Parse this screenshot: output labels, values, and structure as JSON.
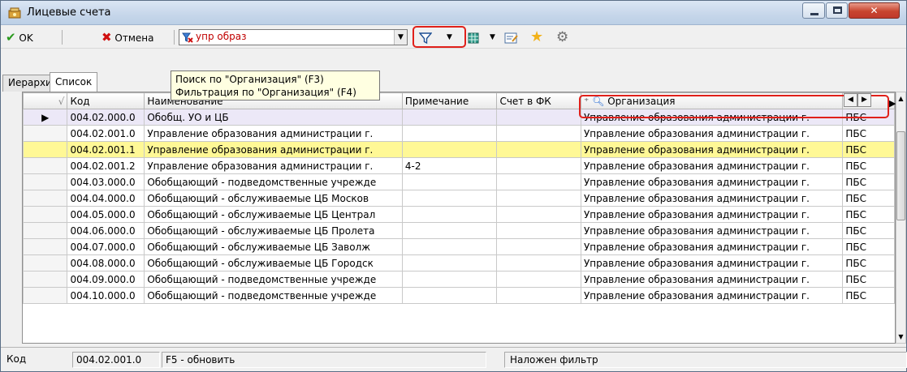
{
  "window": {
    "title": "Лицевые счета"
  },
  "toolbar": {
    "ok_label": "OK",
    "cancel_label": "Отмена",
    "search_value": "упр образ"
  },
  "tooltip": {
    "line1": "Поиск по \"Организация\" (F3)",
    "line2": "Фильтрация по \"Организация\" (F4)"
  },
  "tabs": [
    {
      "label": "Иерархия"
    },
    {
      "label": "Список"
    }
  ],
  "grid": {
    "columns": [
      "Код",
      "Наименование",
      "Примечание",
      "Счет в ФК",
      "Организация"
    ],
    "rows": [
      {
        "code": "004.02.000.0",
        "name": "Обобщ. УО и ЦБ",
        "note": "",
        "fk": "",
        "org": "Управление образования администрации г.",
        "extra": "ПБС"
      },
      {
        "code": "004.02.001.0",
        "name": "Управление образования администрации г.",
        "note": "",
        "fk": "",
        "org": "Управление образования администрации г.",
        "extra": "ПБС"
      },
      {
        "code": "004.02.001.1",
        "name": "Управление образования администрации г.",
        "note": "",
        "fk": "",
        "org": "Управление образования администрации г.",
        "extra": "ПБС"
      },
      {
        "code": "004.02.001.2",
        "name": "Управление образования администрации г.",
        "note": "4-2",
        "fk": "",
        "org": "Управление образования администрации г.",
        "extra": "ПБС"
      },
      {
        "code": "004.03.000.0",
        "name": "Обобщающий - подведомственные учрежде",
        "note": "",
        "fk": "",
        "org": "Управление образования администрации г.",
        "extra": "ПБС"
      },
      {
        "code": "004.04.000.0",
        "name": "Обобщающий - обслуживаемые ЦБ Москов",
        "note": "",
        "fk": "",
        "org": "Управление образования администрации г.",
        "extra": "ПБС"
      },
      {
        "code": "004.05.000.0",
        "name": "Обобщающий - обслуживаемые ЦБ Централ",
        "note": "",
        "fk": "",
        "org": "Управление образования администрации г.",
        "extra": "ПБС"
      },
      {
        "code": "004.06.000.0",
        "name": "Обобщающий - обслуживаемые ЦБ Пролета",
        "note": "",
        "fk": "",
        "org": "Управление образования администрации г.",
        "extra": "ПБС"
      },
      {
        "code": "004.07.000.0",
        "name": "Обобщающий - обслуживаемые ЦБ Заволж",
        "note": "",
        "fk": "",
        "org": "Управление образования администрации г.",
        "extra": "ПБС"
      },
      {
        "code": "004.08.000.0",
        "name": "Обобщающий - обслуживаемые ЦБ Городск",
        "note": "",
        "fk": "",
        "org": "Управление образования администрации г.",
        "extra": "ПБС"
      },
      {
        "code": "004.09.000.0",
        "name": "Обобщающий - подведомственные учрежде",
        "note": "",
        "fk": "",
        "org": "Управление образования администрации г.",
        "extra": "ПБС"
      },
      {
        "code": "004.10.000.0",
        "name": "Обобщающий - подведомственные учрежде",
        "note": "",
        "fk": "",
        "org": "Управление образования администрации г.",
        "extra": "ПБС"
      }
    ]
  },
  "status": {
    "field_label": "Код",
    "field_value": "004.02.001.0",
    "hint": "F5 - обновить",
    "filter_state": "Наложен фильтр"
  },
  "colors": {
    "highlight_row": "#fff896",
    "selected_row": "#ece8f7",
    "annotation_red": "#e0201a",
    "search_text": "#c00000"
  }
}
